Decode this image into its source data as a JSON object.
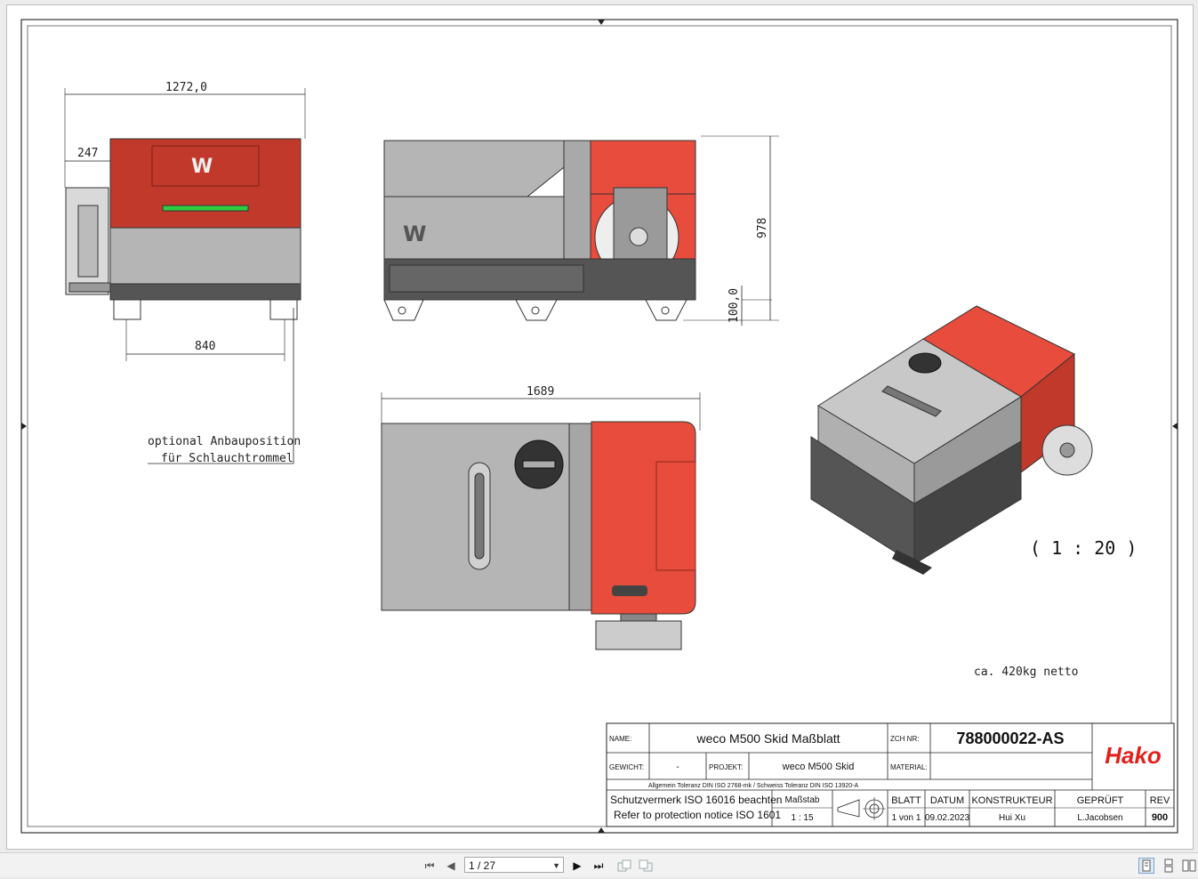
{
  "drawing": {
    "dims": {
      "overall_width": "1272,0",
      "reel_offset": "247",
      "foot_spacing": "840",
      "height": "978",
      "foot_height": "100,0",
      "length": "1689"
    },
    "annotation_line1": "optional Anbauposition",
    "annotation_line2": "für Schlauchtrommel",
    "scale_label": "( 1 : 20 )",
    "weight_label": "ca. 420kg netto"
  },
  "title_block": {
    "name_label": "NAME:",
    "name_value": "weco M500 Skid Maßblatt",
    "zch_label": "ZCH NR:",
    "zch_value": "788000022-AS",
    "weight_label": "GEWICHT:",
    "weight_value": "-",
    "project_label": "PROJEKT:",
    "project_value": "weco M500 Skid",
    "material_label": "MATERIAL:",
    "material_value": "",
    "tolerance": "Allgemein Toleranz DIN ISO 2768-mk / Schweiss Toleranz DIN ISO 13920-A",
    "protection_de": "Schutzvermerk  ISO 16016 beachten",
    "protection_en": "Refer to protection notice ISO 1601",
    "massstab_label": "Maßstab",
    "massstab_value": "1 : 15",
    "blatt_label": "BLATT",
    "blatt_value": "1 von 1",
    "datum_label": "DATUM",
    "datum_value": "09.02.2023",
    "konstrukteur_label": "KONSTRUKTEUR",
    "konstrukteur_value": "Hui Xu",
    "geprueft_label": "GEPRÜFT",
    "geprueft_value": "L.Jacobsen",
    "rev_label": "REV",
    "rev_value": "900",
    "logo_text": "Hako"
  },
  "toolbar": {
    "page_indicator": "1 / 27",
    "dropdown_glyph": "▼",
    "first_glyph": "⏮",
    "prev_glyph": "◀",
    "next_glyph": "▶",
    "last_glyph": "⏭"
  },
  "colors": {
    "red_housing": "#c0392b",
    "bright_red": "#e74c3c",
    "gray_body": "#b5b5b5",
    "dark_base": "#555555",
    "logo_red": "#e2211c"
  }
}
